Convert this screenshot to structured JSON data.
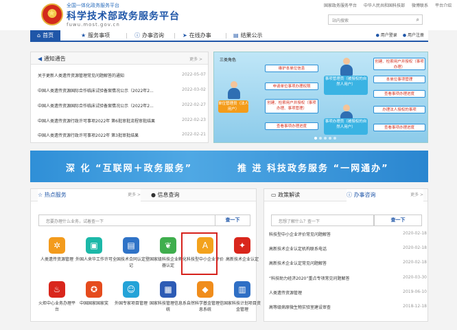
{
  "header": {
    "subtitle": "全国一体化政务服务平台",
    "title": "科学技术部政务服务平台",
    "domain": "fuwu.most.gov.cn",
    "top_links": [
      "国家政务服务平台",
      "中华人民共和国科技部",
      "微博联系",
      "平台介绍"
    ],
    "search_placeholder": "站内搜索"
  },
  "nav": {
    "items": [
      "首页",
      "服务事项",
      "办事咨询",
      "在线办事",
      "结果公示"
    ],
    "login": "用户登录",
    "register": "用户注册"
  },
  "notice": {
    "title": "通知通告",
    "more": "更多 >",
    "rows": [
      {
        "text": "关于更新人类遗传资源管理常见问题解答的通知",
        "date": "2022-05-07"
      },
      {
        "text": "中国人类遗传资源国际合作临床试验备案情况公示（2022年2...",
        "date": "2022-03-02"
      },
      {
        "text": "中国人类遗传资源国际合作临床试验备案情况公示（2022年2...",
        "date": "2022-02-27"
      },
      {
        "text": "中国人类遗传资源行政许可事项2022年 第6批审批流程审批结果",
        "date": "2022-02-23"
      },
      {
        "text": "中国人类遗传资源行政许可事项2022年 第3批审批结果",
        "date": "2022-02-21"
      }
    ]
  },
  "banner": {
    "roles_label": "三类角色",
    "unit_admin": "单位管理员（法人用户）",
    "affair_admin": "事项管理员（被授权的自然人用户）",
    "affair_handler": "事项办理员（被授权的自然人用户）",
    "box1": "维护本单位信息",
    "box2": "申请单位事项办理权限",
    "box3": "创建、检索用户并授权（事项办理、事项管理）",
    "box4": "查看事项办理进度",
    "box5": "创建、检索用户并授权（事项办理）",
    "box6": "本单位事项管理",
    "box7": "查看事项办理进度",
    "box8": "办理法人授权的事项",
    "box9": "查看事项办理进度"
  },
  "slogan": {
    "left": "深 化 “互联网＋政务服务”",
    "right": "推 进 科技政务服务 “一网通办”"
  },
  "hot": {
    "tab1": "热点服务",
    "tab2": "信息查询",
    "more": "更多 >",
    "search_placeholder": "您要办理什么业务，试着查一下",
    "search_btn": "查一下",
    "items": [
      "人类遗传资源管理",
      "外国人来华工作许可",
      "全国技术合同认定登记",
      "国家级科技企业孵化器认定",
      "科技型中小企业评价",
      "高新技术企业认定",
      "火炬中心业务办理平台",
      "中国国家国家奖",
      "外国专家项目管理",
      "国家科技管理信息系统",
      "自然科学基金管理信息系统",
      "国家科技计划项目资金管理"
    ]
  },
  "policy": {
    "tab1": "政策解读",
    "tab2": "办事咨询",
    "more": "更多 >",
    "search_placeholder": "您想了解什么？查一下",
    "search_btn": "查一下",
    "rows": [
      {
        "text": "科技型中小企业评价常见问题解答",
        "date": "2020-02-18"
      },
      {
        "text": "高新技术企业认定机构联系电话",
        "date": "2020-02-18"
      },
      {
        "text": "高新技术企业认定常见问题解答",
        "date": "2020-02-18"
      },
      {
        "text": "“科技助力经济2020”重点专项常见问题解答",
        "date": "2020-03-30"
      },
      {
        "text": "人类遗传资源管理",
        "date": "2019-06-10"
      },
      {
        "text": "高等级病原微生物实验室建设审查",
        "date": "2018-12-18"
      }
    ]
  }
}
